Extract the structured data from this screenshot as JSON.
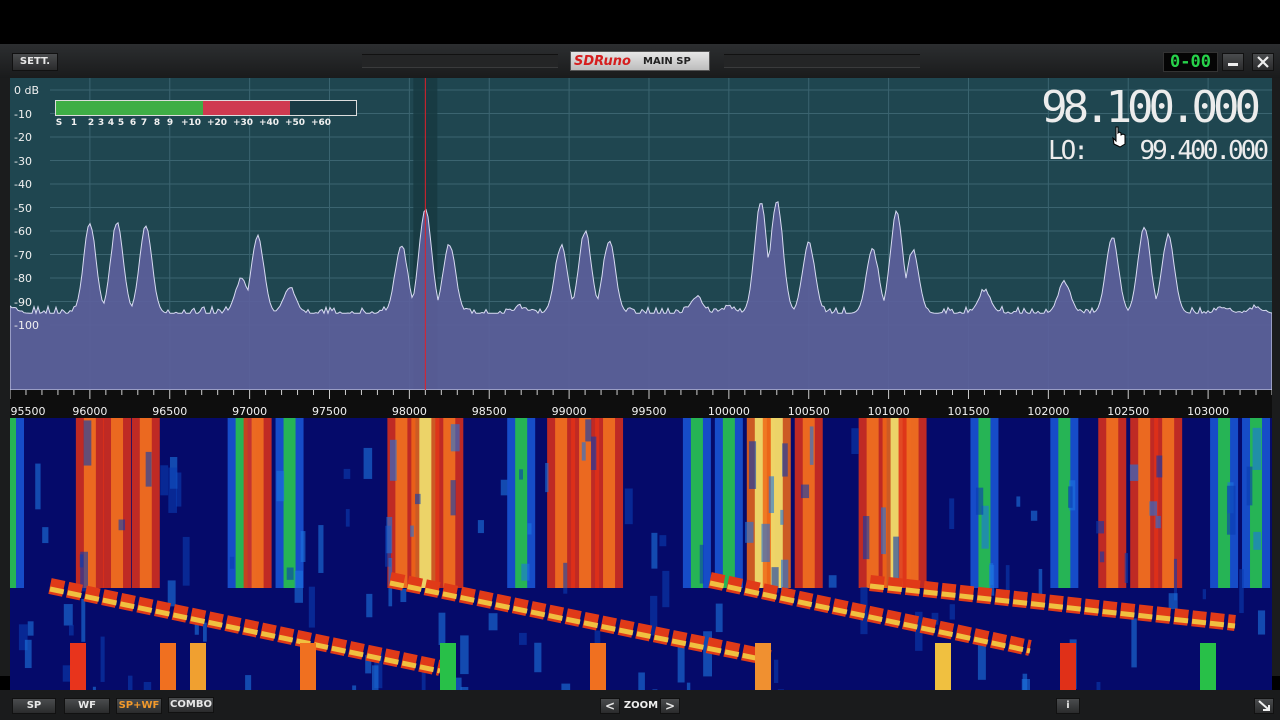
{
  "window": {
    "settings_label": "SETT.",
    "brand": "SDRuno",
    "panel_title": "MAIN SP",
    "clock": "0-00"
  },
  "tuning": {
    "frequency": "98.100.000",
    "lo_label": "LO:",
    "lo_value": "99.400.000"
  },
  "smeter": {
    "scale": [
      "S",
      "1",
      "2",
      "3",
      "4",
      "5",
      "6",
      "7",
      "8",
      "9",
      "+10",
      "+20",
      "+30",
      "+40",
      "+50",
      "+60"
    ],
    "green_fraction": 0.49,
    "red_fraction": 0.29,
    "colors": {
      "green": "#3fae46",
      "red": "#cf3a50",
      "frame": "#dddddd"
    }
  },
  "spectrum": {
    "db_labels": [
      "0 dB",
      "-10",
      "-20",
      "-30",
      "-40",
      "-50",
      "-60",
      "-70",
      "-80",
      "-90",
      "-100"
    ],
    "freq_labels": [
      "95500",
      "96000",
      "96500",
      "97000",
      "97500",
      "98000",
      "98500",
      "99000",
      "99500",
      "100000",
      "100500",
      "101000",
      "101500",
      "102000",
      "102500",
      "103000"
    ],
    "fill_color": "#5d5f9c",
    "bg_color": "#1f4650",
    "tuned_khz": 98100,
    "signals_khz_db": [
      [
        95500,
        -92
      ],
      [
        96000,
        -57
      ],
      [
        96170,
        -56
      ],
      [
        96350,
        -58
      ],
      [
        96950,
        -80
      ],
      [
        97050,
        -62
      ],
      [
        97250,
        -84
      ],
      [
        97950,
        -66
      ],
      [
        98100,
        -50
      ],
      [
        98250,
        -66
      ],
      [
        98700,
        -92
      ],
      [
        98950,
        -66
      ],
      [
        99100,
        -60
      ],
      [
        99250,
        -64
      ],
      [
        99800,
        -88
      ],
      [
        100000,
        -92
      ],
      [
        100200,
        -48
      ],
      [
        100300,
        -47
      ],
      [
        100500,
        -65
      ],
      [
        100900,
        -68
      ],
      [
        101050,
        -52
      ],
      [
        101150,
        -68
      ],
      [
        101600,
        -85
      ],
      [
        102100,
        -82
      ],
      [
        102400,
        -62
      ],
      [
        102600,
        -58
      ],
      [
        102750,
        -62
      ],
      [
        103100,
        -92
      ],
      [
        103300,
        -92
      ]
    ]
  },
  "bottom_bar": {
    "sp_label": "SP",
    "wf_label": "WF",
    "spwf_label": "SP+WF",
    "combo_label": "COMBO",
    "zoom_label": "ZOOM",
    "zoom_left": "<",
    "zoom_right": ">",
    "info_label": "i"
  }
}
